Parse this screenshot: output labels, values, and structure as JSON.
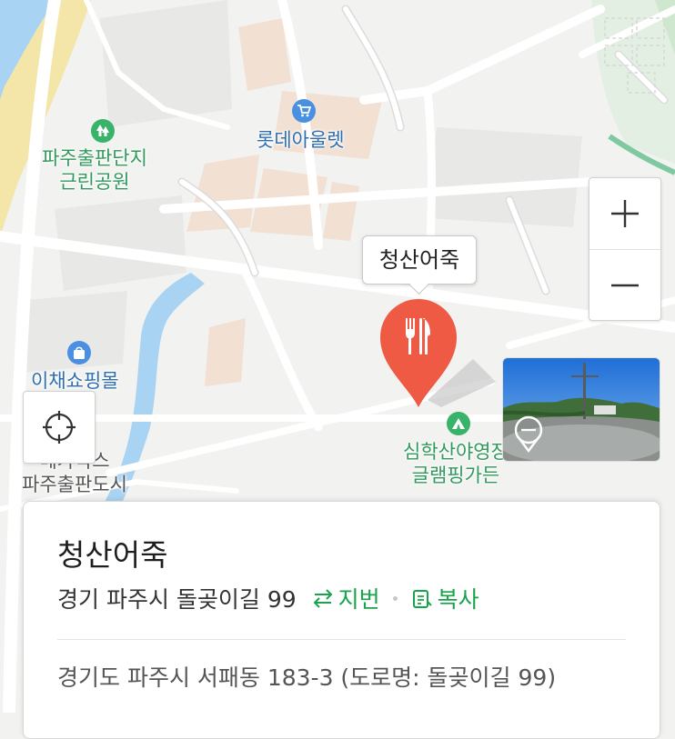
{
  "place_callout": {
    "name": "청산어죽"
  },
  "map_labels": {
    "park": {
      "line1": "파주출판단지",
      "line2": "근린공원"
    },
    "outlet": "롯데아울렛",
    "mall": "이채쇼핑몰",
    "cinema": {
      "line1": "메가박스",
      "line2": "파주출판도시"
    },
    "campsite": {
      "line1": "심학산야영장",
      "line2": "글램핑가든"
    }
  },
  "icons": {
    "park": "tree-icon",
    "outlet": "shopping-cart-icon",
    "mall": "shopping-bag-icon",
    "campsite": "tent-icon",
    "marker": "restaurant-utensils-icon"
  },
  "controls": {
    "zoom_in_icon": "plus-icon",
    "zoom_out_icon": "minus-icon",
    "locate_icon": "crosshair-icon"
  },
  "info_card": {
    "title": "청산어죽",
    "address": "경기 파주시 돌곶이길 99",
    "jibun_label": "지번",
    "copy_label": "복사",
    "road_address": "경기도 파주시 서패동 183-3 (도로명: 돌곶이길 99)"
  },
  "colors": {
    "marker": "#ef5a45",
    "action_green": "#19a34a",
    "park_label": "#2f9a5c",
    "poi_blue": "#4a90e2",
    "river": "#a9d3f2"
  }
}
